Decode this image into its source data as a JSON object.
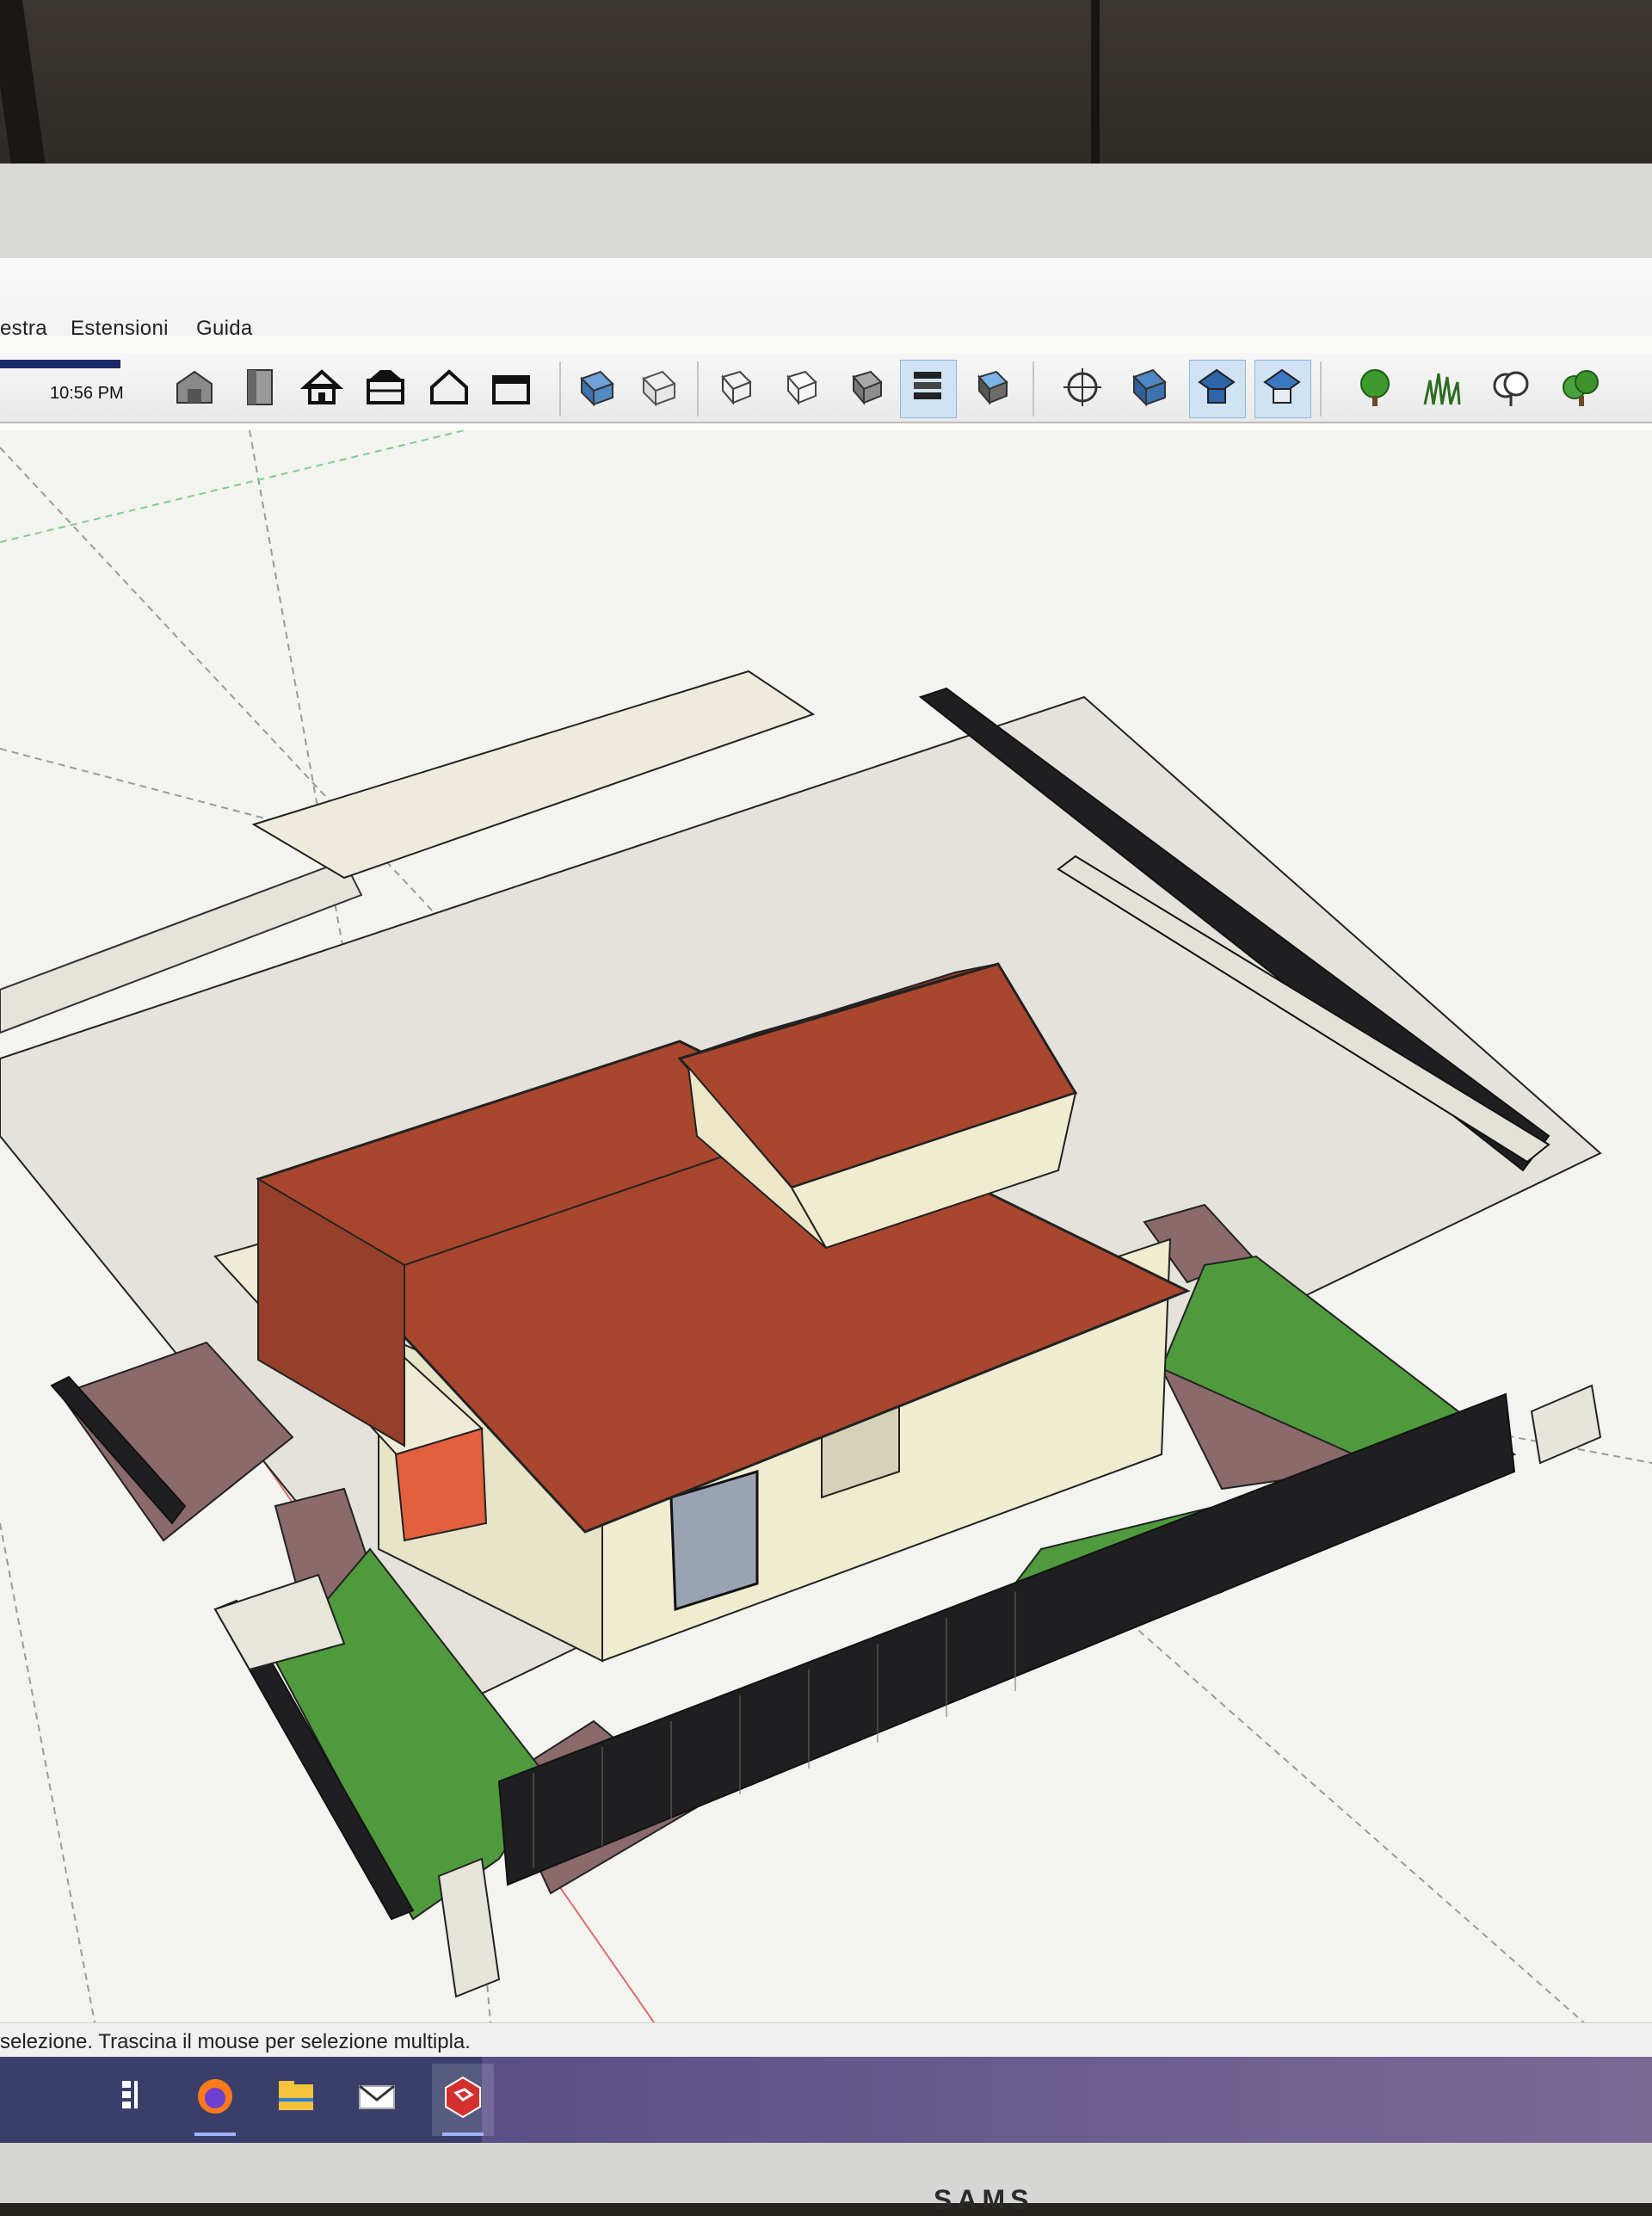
{
  "menu": {
    "items": [
      "estra",
      "Estensioni",
      "Guida"
    ]
  },
  "toolbar": {
    "clock": "10:56 PM",
    "icons": [
      "warehouse-icon",
      "door-icon",
      "house-icon",
      "garage-icon",
      "house-outline-icon",
      "box-house-icon",
      "iso-view-icon",
      "top-view-icon",
      "front-view-icon",
      "right-view-icon",
      "back-view-icon",
      "left-view-icon",
      "bottom-view-icon",
      "orbit-icon",
      "section-icon",
      "walk-icon",
      "look-around-icon",
      "tree-icon",
      "grass-icon",
      "shrub-icon",
      "bush-icon"
    ]
  },
  "status": {
    "text": "selezione. Trascina il mouse per selezione multipla."
  },
  "taskbar": {
    "icons": [
      "task-view-icon",
      "firefox-icon",
      "file-explorer-icon",
      "mail-icon",
      "sketchup-icon"
    ]
  },
  "monitor": {
    "brand": "SAMS"
  },
  "colors": {
    "roof": "#a9472e",
    "walls": "#f0ecd0",
    "lawn": "#4f9a3c",
    "paving": "#8b6a6c",
    "fence": "#1f1f22",
    "ground": "#e4e2da"
  }
}
